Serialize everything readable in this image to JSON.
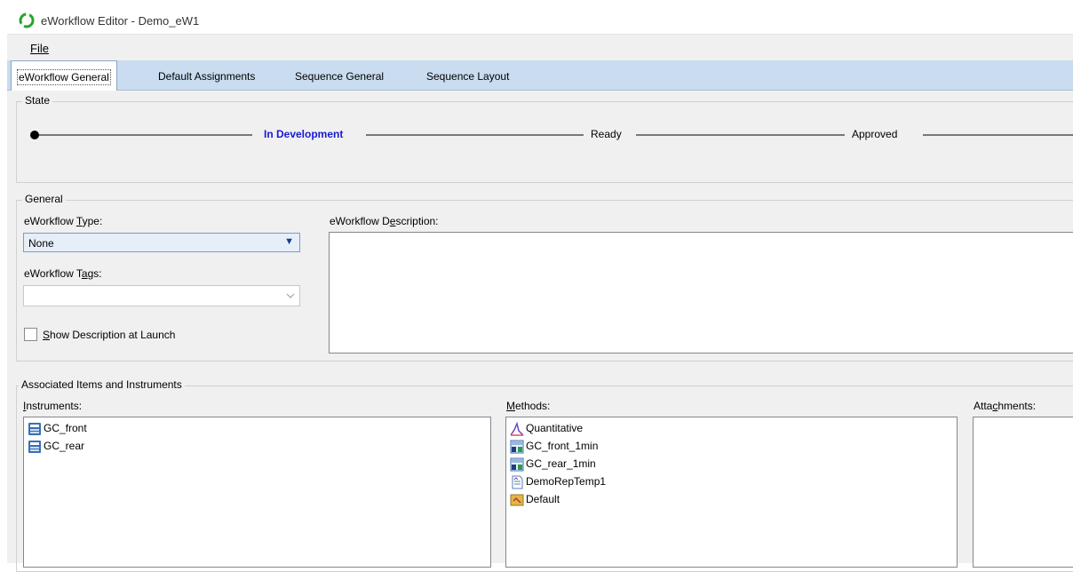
{
  "window": {
    "title": "eWorkflow Editor - Demo_eW1"
  },
  "menu": {
    "file": "File"
  },
  "tabs": [
    {
      "label": "eWorkflow General",
      "active": true
    },
    {
      "label": "Default Assignments"
    },
    {
      "label": "Sequence General"
    },
    {
      "label": "Sequence Layout"
    }
  ],
  "state": {
    "legend": "State",
    "steps": [
      "In Development",
      "Ready",
      "Approved"
    ],
    "current": "In Development",
    "current_color": "#1a1ad6"
  },
  "general": {
    "legend": "General",
    "type_label": "eWorkflow Type:",
    "type_value": "None",
    "tags_label": "eWorkflow Tags:",
    "tags_value": "",
    "show_desc_label": "Show Description at Launch",
    "show_desc_checked": false,
    "description_label": "eWorkflow Description:",
    "description_value": ""
  },
  "associated": {
    "legend": "Associated Items and Instruments",
    "instruments_label": "Instruments:",
    "instruments": [
      {
        "name": "GC_front",
        "icon": "instrument-icon"
      },
      {
        "name": "GC_rear",
        "icon": "instrument-icon"
      }
    ],
    "methods_label": "Methods:",
    "methods": [
      {
        "name": "Quantitative",
        "icon": "processing-method-icon"
      },
      {
        "name": "GC_front_1min",
        "icon": "instrument-method-icon"
      },
      {
        "name": "GC_rear_1min",
        "icon": "instrument-method-icon"
      },
      {
        "name": "DemoRepTemp1",
        "icon": "report-template-icon"
      },
      {
        "name": "Default",
        "icon": "default-method-icon"
      }
    ],
    "attachments_label": "Attachments:",
    "attachments": []
  }
}
